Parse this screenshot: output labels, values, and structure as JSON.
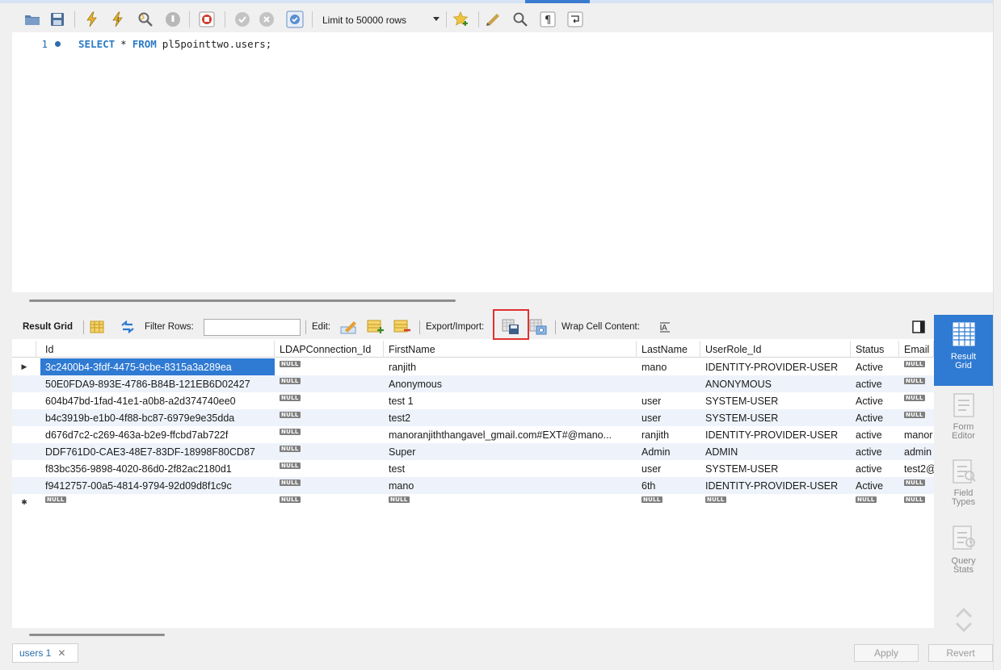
{
  "toolbar": {
    "limit_label": "Limit to 50000 rows",
    "icons": [
      "open-folder-icon",
      "save-icon",
      "execute-icon",
      "execute-current-icon",
      "explain-icon",
      "stop-icon",
      "toggle-error-icon",
      "commit-icon",
      "rollback-icon",
      "autocommit-icon",
      "bookmark-icon",
      "beautify-icon",
      "find-icon",
      "invisible-chars-icon",
      "wrap-icon"
    ]
  },
  "editor": {
    "line_number": "1",
    "kw_select": "SELECT",
    "star": "*",
    "kw_from": "FROM",
    "table": "pl5pointtwo.users;"
  },
  "result_toolbar": {
    "result_grid": "Result Grid",
    "filter_rows": "Filter Rows:",
    "edit": "Edit:",
    "export_import": "Export/Import:",
    "wrap_cell": "Wrap Cell Content:"
  },
  "grid": {
    "columns": [
      "Id",
      "LDAPConnection_Id",
      "FirstName",
      "LastName",
      "UserRole_Id",
      "Status",
      "Email"
    ],
    "null_text": "NULL",
    "rows": [
      {
        "id": "3c2400b4-3fdf-4475-9cbe-8315a3a289ea",
        "ldap": "NULL",
        "first": "ranjith",
        "last": "mano",
        "role": "IDENTITY-PROVIDER-USER",
        "status": "Active",
        "email": "NULL"
      },
      {
        "id": "50E0FDA9-893E-4786-B84B-121EB6D02427",
        "ldap": "NULL",
        "first": "Anonymous",
        "last": "",
        "role": "ANONYMOUS",
        "status": "active",
        "email": "NULL"
      },
      {
        "id": "604b47bd-1fad-41e1-a0b8-a2d374740ee0",
        "ldap": "NULL",
        "first": "test 1",
        "last": "user",
        "role": "SYSTEM-USER",
        "status": "Active",
        "email": "NULL"
      },
      {
        "id": "b4c3919b-e1b0-4f88-bc87-6979e9e35dda",
        "ldap": "NULL",
        "first": "test2",
        "last": "user",
        "role": "SYSTEM-USER",
        "status": "Active",
        "email": "NULL"
      },
      {
        "id": "d676d7c2-c269-463a-b2e9-ffcbd7ab722f",
        "ldap": "NULL",
        "first": "manoranjiththangavel_gmail.com#EXT#@mano...",
        "last": "ranjith",
        "role": "IDENTITY-PROVIDER-USER",
        "status": "active",
        "email": "manor"
      },
      {
        "id": "DDF761D0-CAE3-48E7-83DF-18998F80CD87",
        "ldap": "NULL",
        "first": "Super",
        "last": "Admin",
        "role": "ADMIN",
        "status": "active",
        "email": "admin"
      },
      {
        "id": "f83bc356-9898-4020-86d0-2f82ac2180d1",
        "ldap": "NULL",
        "first": "test",
        "last": "user",
        "role": "SYSTEM-USER",
        "status": "active",
        "email": "test2@"
      },
      {
        "id": "f9412757-00a5-4814-9794-92d09d8f1c9c",
        "ldap": "NULL",
        "first": "mano",
        "last": "6th",
        "role": "IDENTITY-PROVIDER-USER",
        "status": "Active",
        "email": "NULL"
      }
    ]
  },
  "side_panel": {
    "result_grid": "Result Grid",
    "form_editor": "Form Editor",
    "field_types": "Field Types",
    "query_stats": "Query Stats"
  },
  "bottom": {
    "tab_label": "users 1",
    "apply": "Apply",
    "revert": "Revert"
  },
  "colors": {
    "accent": "#2f7ad2",
    "highlight": "#e0312e",
    "keyword": "#2c7bc4"
  }
}
